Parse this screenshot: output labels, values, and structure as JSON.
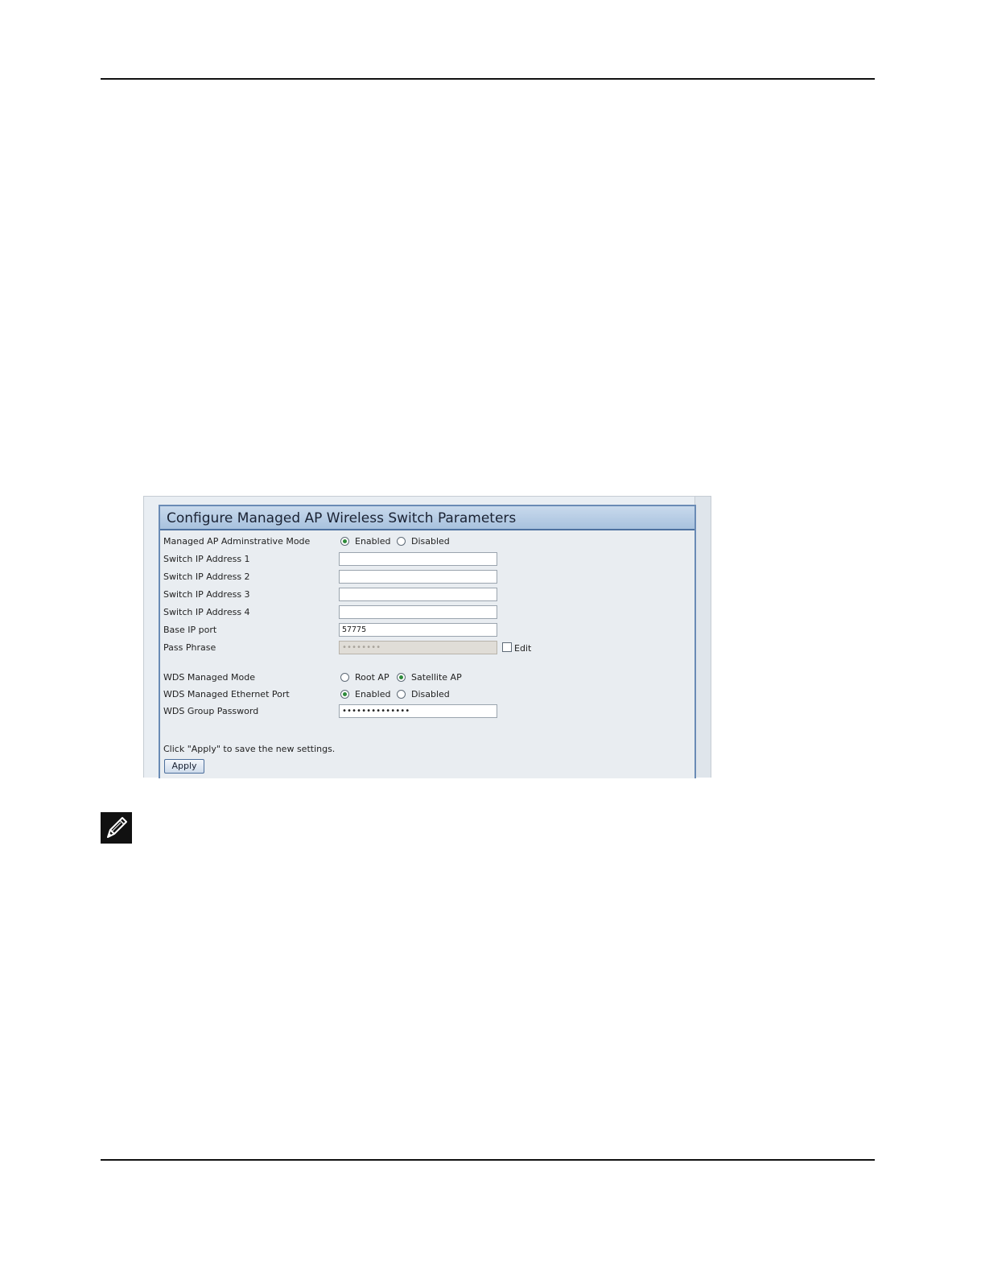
{
  "panel": {
    "title": "Configure Managed AP Wireless Switch Parameters"
  },
  "form": {
    "admin_mode": {
      "label": "Managed AP Adminstrative Mode",
      "options": [
        "Enabled",
        "Disabled"
      ],
      "selected": "Enabled"
    },
    "switch_ip_1": {
      "label": "Switch IP Address 1",
      "value": ""
    },
    "switch_ip_2": {
      "label": "Switch IP Address 2",
      "value": ""
    },
    "switch_ip_3": {
      "label": "Switch IP Address 3",
      "value": ""
    },
    "switch_ip_4": {
      "label": "Switch IP Address 4",
      "value": ""
    },
    "base_ip_port": {
      "label": "Base IP port",
      "value": "57775"
    },
    "pass_phrase": {
      "label": "Pass Phrase",
      "value": "••••••••",
      "edit_label": "Edit",
      "edit_checked": false
    },
    "wds_mode": {
      "label": "WDS Managed Mode",
      "options": [
        "Root AP",
        "Satellite AP"
      ],
      "selected": "Satellite AP"
    },
    "wds_eth_port": {
      "label": "WDS Managed Ethernet Port",
      "options": [
        "Enabled",
        "Disabled"
      ],
      "selected": "Enabled"
    },
    "wds_group_password": {
      "label": "WDS Group Password",
      "value": "••••••••••••••"
    },
    "hint": "Click \"Apply\" to save the new settings.",
    "apply_label": "Apply"
  },
  "icons": {
    "note": "pencil-note-icon"
  }
}
